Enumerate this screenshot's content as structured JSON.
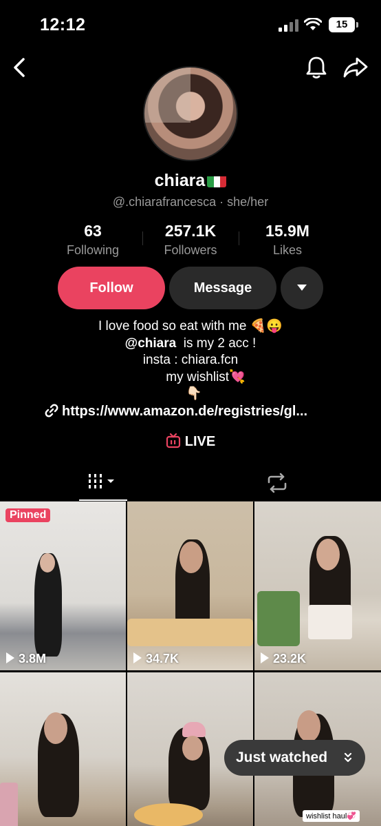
{
  "status_bar": {
    "time": "12:12",
    "battery": "15"
  },
  "profile": {
    "username": "chiara",
    "handle": "@.chiarafrancesca · she/her",
    "stats": [
      {
        "value": "63",
        "label": "Following"
      },
      {
        "value": "257.1K",
        "label": "Followers"
      },
      {
        "value": "15.9M",
        "label": "Likes"
      }
    ]
  },
  "actions": {
    "follow": "Follow",
    "message": "Message"
  },
  "bio": {
    "line1": "I love food so eat with me 🍕😛",
    "line2_mention": "@chiara",
    "line2_rest": "  is my 2 acc !",
    "line3": "insta : chiara.fcn",
    "line4": "my wishlist💘",
    "line5": "👇🏻"
  },
  "link": "https://www.amazon.de/registries/gl...",
  "live_label": "LIVE",
  "videos": [
    {
      "views": "3.8M",
      "pinned": "Pinned"
    },
    {
      "views": "34.7K"
    },
    {
      "views": "23.2K"
    },
    {
      "views": ""
    },
    {
      "views": ""
    },
    {
      "views": "",
      "tag": "wishlist haul💞"
    }
  ],
  "just_watched": "Just watched",
  "colors": {
    "accent": "#ea4360",
    "button_dark": "#2a2a2a",
    "muted_text": "#9a9a9a"
  }
}
